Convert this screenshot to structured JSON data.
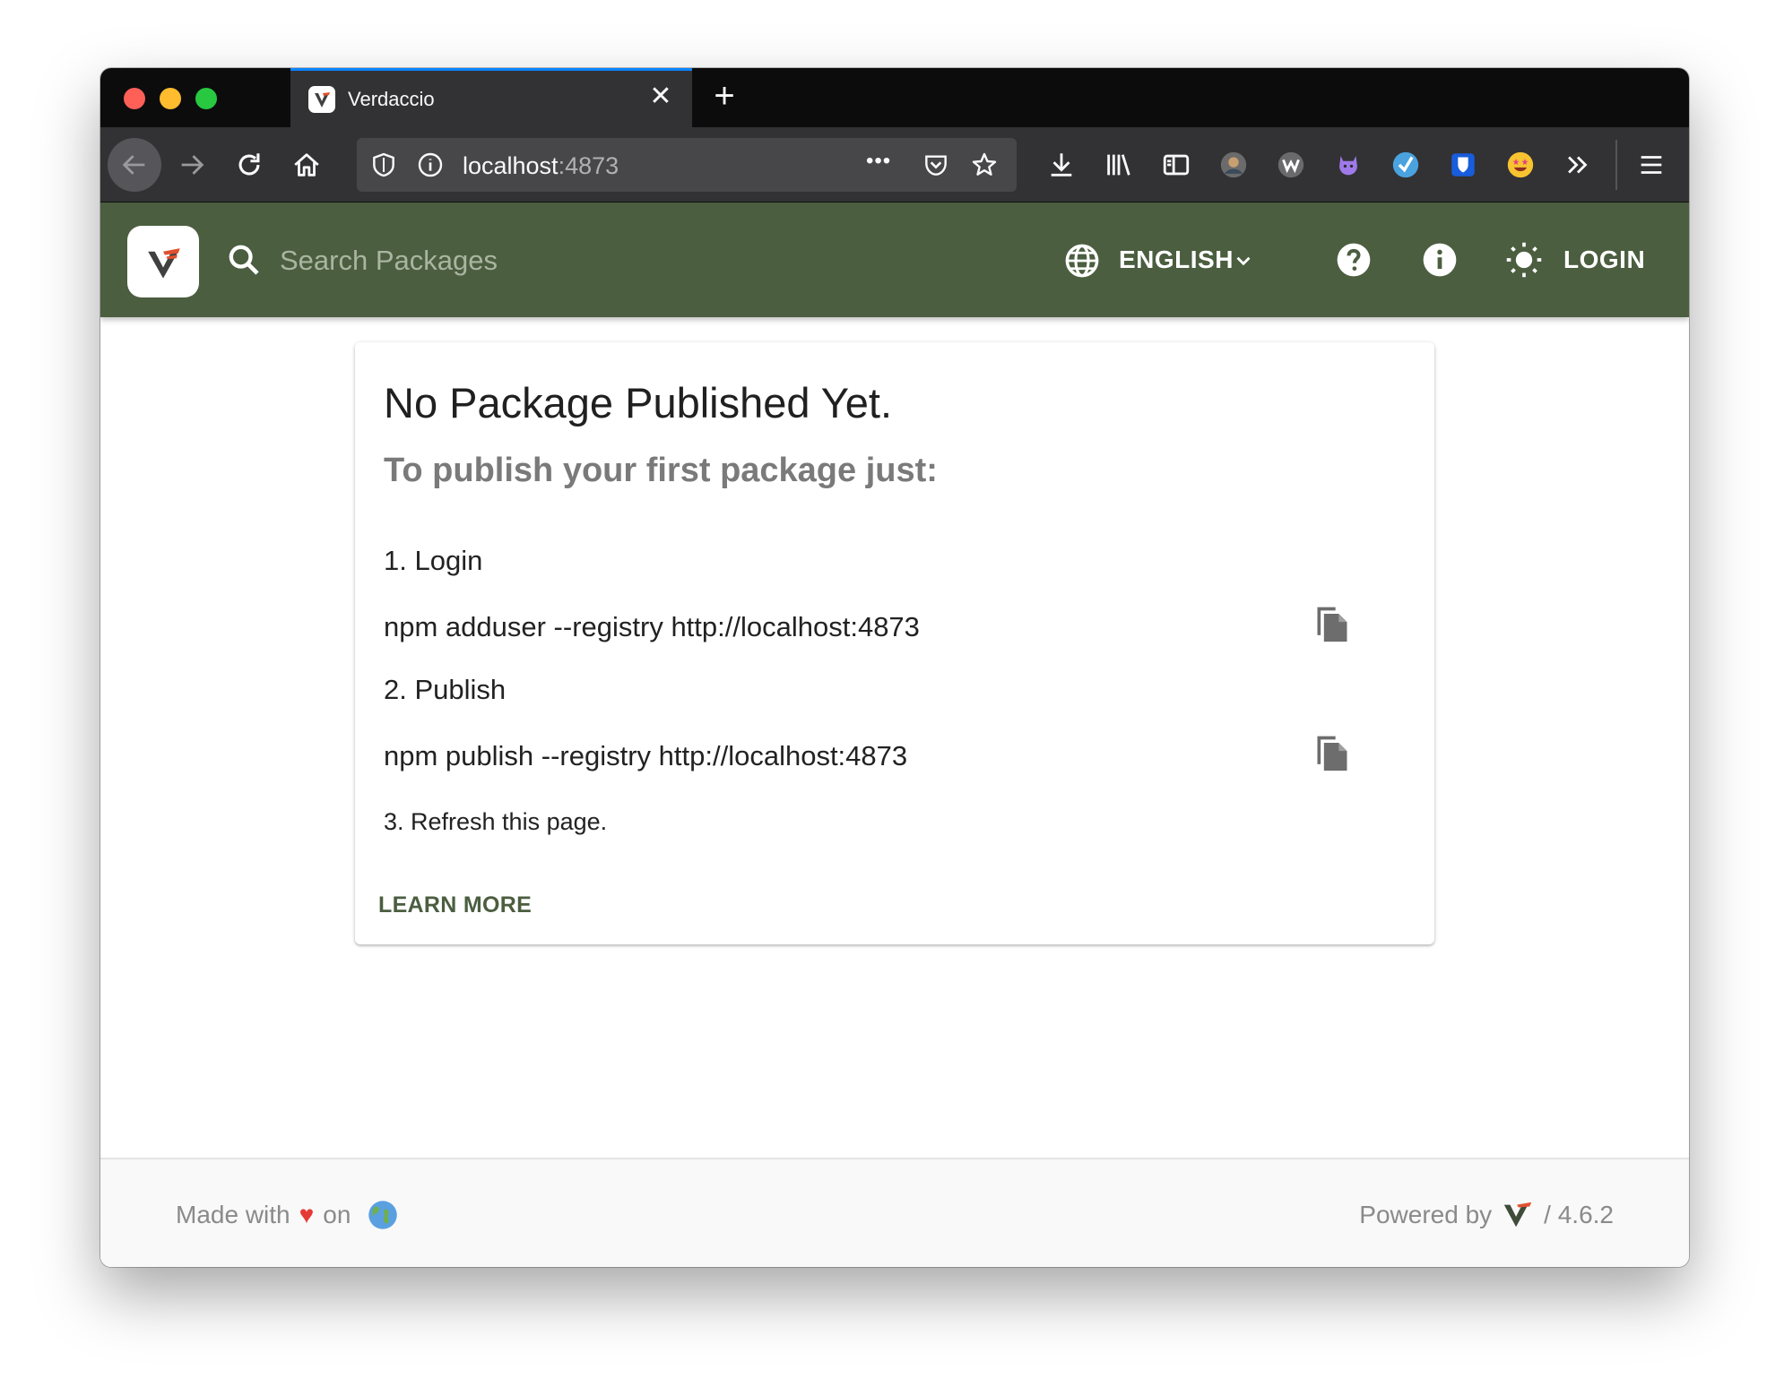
{
  "browser": {
    "tab_title": "Verdaccio",
    "tab_close": "✕",
    "new_tab": "+",
    "url_host": "localhost",
    "url_port": ":4873",
    "url_more": "•••"
  },
  "header": {
    "search_placeholder": "Search Packages",
    "language": "ENGLISH",
    "login": "LOGIN"
  },
  "card": {
    "title": "No Package Published Yet.",
    "subtitle": "To publish your first package just:",
    "step1_label": "1. Login",
    "step1_cmd": "npm adduser --registry http://localhost:4873",
    "step2_label": "2. Publish",
    "step2_cmd": "npm publish --registry http://localhost:4873",
    "step3_label": "3. Refresh this page.",
    "learn_more": "LEARN MORE"
  },
  "footer": {
    "made_with": "Made with",
    "heart": "♥",
    "on": "on",
    "powered_by": "Powered by",
    "version": "/ 4.6.2"
  },
  "colors": {
    "header_bg": "#4b5e40",
    "accent": "#4b5e40"
  }
}
